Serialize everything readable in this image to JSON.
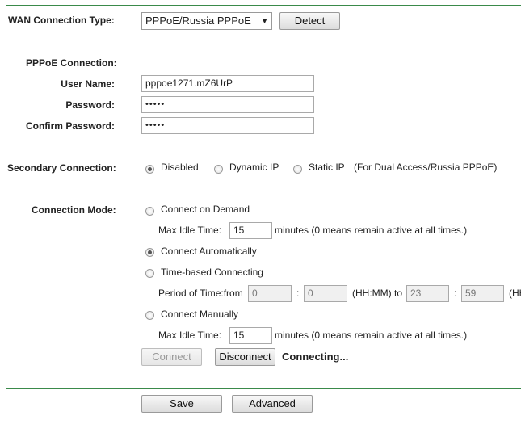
{
  "wan": {
    "label": "WAN Connection Type:",
    "selected": "PPPoE/Russia PPPoE",
    "detect_label": "Detect"
  },
  "pppoe": {
    "section_label": "PPPoE Connection:",
    "username_label": "User Name:",
    "username_value": "pppoe1271.mZ6UrP",
    "password_label": "Password:",
    "password_value": "•••••",
    "confirm_label": "Confirm Password:",
    "confirm_value": "•••••"
  },
  "secondary": {
    "label": "Secondary Connection:",
    "options": [
      "Disabled",
      "Dynamic IP",
      "Static IP"
    ],
    "selected": "Disabled",
    "note": "(For Dual Access/Russia PPPoE)"
  },
  "mode": {
    "label": "Connection Mode:",
    "on_demand": "Connect on Demand",
    "idle_label": "Max Idle Time:",
    "idle_value_1": "15",
    "idle_note": "minutes (0 means remain active at all times.)",
    "automatic": "Connect Automatically",
    "time_based": "Time-based Connecting",
    "period_label": "Period of Time:from",
    "from_h": "0",
    "colon": ":",
    "from_m": "0",
    "hhmm_to": "(HH:MM) to",
    "to_h": "23",
    "to_m": "59",
    "hhmm_tail": "(HH:MM)",
    "manual": "Connect Manually",
    "idle_value_2": "15",
    "selected": "Connect Automatically",
    "connect_label": "Connect",
    "disconnect_label": "Disconnect",
    "status": "Connecting..."
  },
  "footer": {
    "save_label": "Save",
    "advanced_label": "Advanced"
  }
}
